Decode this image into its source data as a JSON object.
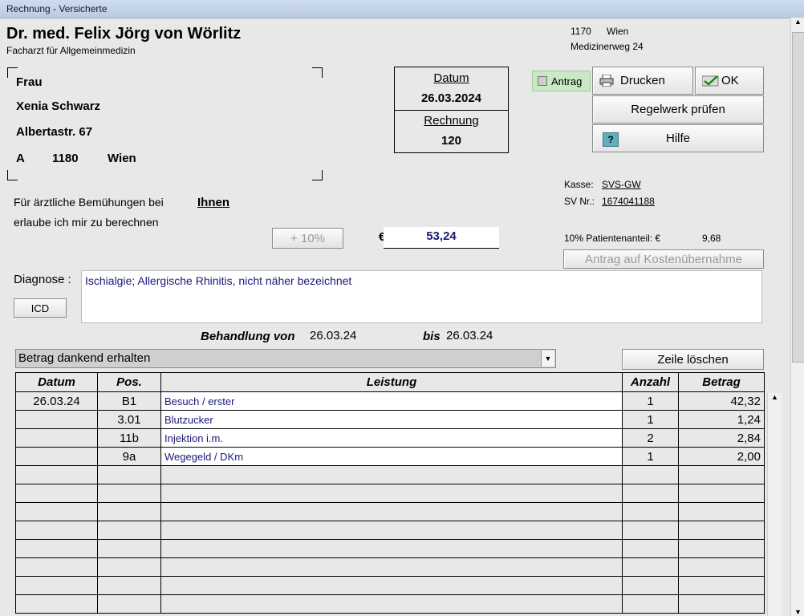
{
  "window": {
    "title": "Rechnung - Versicherte"
  },
  "doctor": {
    "name": "Dr. med. Felix Jörg von Wörlitz",
    "specialty": "Facharzt für Allgemeinmedizin",
    "zip": "1170",
    "city": "Wien",
    "street": "Medizinerweg 24"
  },
  "patient": {
    "salutation": "Frau",
    "name": "Xenia Schwarz",
    "street": "Albertastr. 67",
    "country": "A",
    "zip": "1180",
    "city": "Wien"
  },
  "invoice": {
    "date_label": "Datum",
    "date": "26.03.2024",
    "number_label": "Rechnung",
    "number": "120"
  },
  "buttons": {
    "antrag": "Antrag",
    "print": "Drucken",
    "ok": "OK",
    "check_rules": "Regelwerk prüfen",
    "help": "Hilfe",
    "help_icon": "?",
    "plus10": "+ 10%",
    "cost_request": "Antrag auf Kostenübernahme",
    "icd": "ICD",
    "delete_row": "Zeile löschen"
  },
  "insurance": {
    "kasse_label": "Kasse:",
    "kasse": "SVS-GW",
    "sv_label": "SV Nr.:",
    "sv_nr": "1674041188",
    "share_label": "10% Patientenanteil: €",
    "share": "9,68"
  },
  "text": {
    "line1": "Für ärztliche Bemühungen bei",
    "ihnen": "Ihnen",
    "line2": "erlaube ich mir zu berechnen",
    "currency": "€",
    "total": "53,24",
    "diagnose_label": "Diagnose :",
    "diagnose": "Ischialgie; Allergische Rhinitis, nicht näher bezeichnet",
    "behandlung_label": "Behandlung von",
    "from": "26.03.24",
    "bis_label": "bis",
    "to": "26.03.24",
    "payment": "Betrag dankend erhalten"
  },
  "table": {
    "headers": {
      "datum": "Datum",
      "pos": "Pos.",
      "leistung": "Leistung",
      "anzahl": "Anzahl",
      "betrag": "Betrag"
    },
    "rows": [
      {
        "datum": "26.03.24",
        "pos": "B1",
        "leistung": "Besuch / erster",
        "anzahl": "1",
        "betrag": "42,32"
      },
      {
        "datum": "",
        "pos": "3.01",
        "leistung": "Blutzucker",
        "anzahl": "1",
        "betrag": "1,24"
      },
      {
        "datum": "",
        "pos": "11b",
        "leistung": "Injektion i.m.",
        "anzahl": "2",
        "betrag": "2,84"
      },
      {
        "datum": "",
        "pos": "9a",
        "leistung": "Wegegeld / DKm",
        "anzahl": "1",
        "betrag": "2,00"
      }
    ]
  }
}
